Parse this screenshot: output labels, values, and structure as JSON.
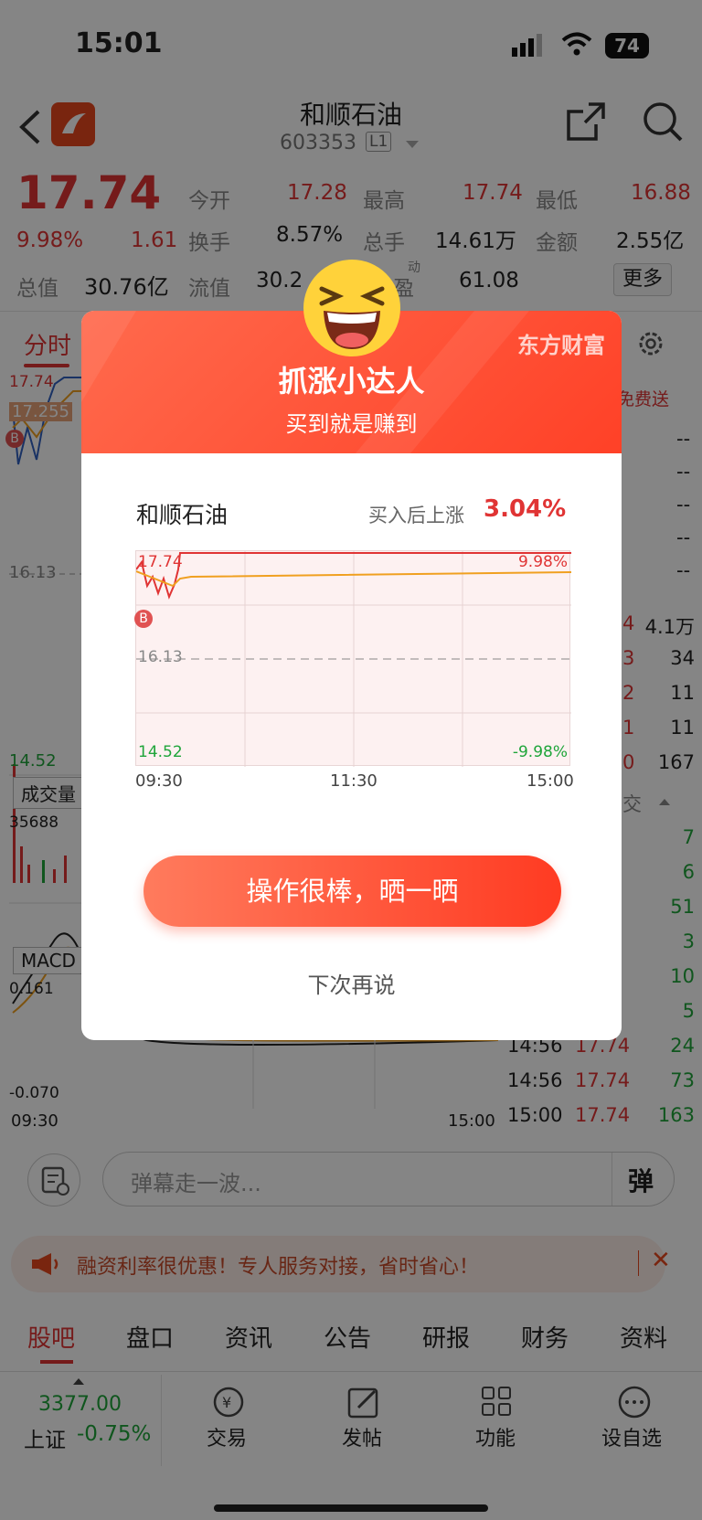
{
  "status": {
    "time": "15:01",
    "battery": "74"
  },
  "header": {
    "stock_name": "和顺石油",
    "code": "603353",
    "level": "L1"
  },
  "quote": {
    "price": "17.74",
    "pct": "9.98%",
    "chg": "1.61",
    "open_label": "今开",
    "open": "17.28",
    "high_label": "最高",
    "high": "17.74",
    "low_label": "最低",
    "low": "16.88",
    "turnover_label": "换手",
    "turnover": "8.57%",
    "vol_label": "总手",
    "vol": "14.61万",
    "amount_label": "金额",
    "amount": "2.55亿",
    "mcap_label": "总值",
    "mcap": "30.76亿",
    "float_label": "流值",
    "float": "30.2",
    "pe_label": "盈",
    "pe_sup": "动",
    "pe": "61.08",
    "more": "更多"
  },
  "tabs": {
    "active": "分时",
    "gift": "免费送"
  },
  "chart_labels": {
    "top": "17.74",
    "avg": "17.255",
    "mid": "16.13",
    "bottom": "14.52",
    "vol_tag": "成交量",
    "vol_max": "35688",
    "macd_tag": "MACD",
    "macd_top": "0.161",
    "macd_bot": "-0.070",
    "t_start": "09:30",
    "t_end": "15:00",
    "buy_marker": "B"
  },
  "orderbook": {
    "dashes": [
      "--",
      "--",
      "--",
      "--",
      "--",
      "--",
      "--",
      "--",
      "--",
      "--"
    ],
    "levels": [
      "4.1万",
      "34",
      "11",
      "11",
      "167"
    ],
    "level_prices": [
      "4",
      "3",
      "2",
      "1",
      "0"
    ],
    "trade_header": "交",
    "vols": [
      "7",
      "6",
      "51",
      "3",
      "10",
      "5"
    ],
    "trades": [
      {
        "t": "14:56",
        "p": "17.74",
        "v": "24"
      },
      {
        "t": "14:56",
        "p": "17.74",
        "v": "73"
      },
      {
        "t": "15:00",
        "p": "17.74",
        "v": "163"
      }
    ]
  },
  "comment": {
    "placeholder": "弹幕走一波...",
    "danmu": "弹"
  },
  "ad": {
    "text": "融资利率很优惠！专人服务对接，省时省心！"
  },
  "bottom_tabs": [
    "股吧",
    "盘口",
    "资讯",
    "公告",
    "研报",
    "财务",
    "资料"
  ],
  "toolbar": {
    "index_value": "3377.00",
    "index_name": "上证",
    "index_pct": "-0.75%",
    "trade": "交易",
    "post": "发帖",
    "func": "功能",
    "watch": "设自选"
  },
  "modal": {
    "brand": "东方财富",
    "title": "抓涨小达人",
    "subtitle": "买到就是赚到",
    "stock": "和顺石油",
    "gain_label": "买入后上涨",
    "gain": "3.04%",
    "chart": {
      "top": "17.74",
      "top_pct": "9.98%",
      "mid": "16.13",
      "bottom": "14.52",
      "bottom_pct": "-9.98%",
      "t1": "09:30",
      "t2": "11:30",
      "t3": "15:00",
      "marker": "B"
    },
    "cta": "操作很棒，晒一晒",
    "dismiss": "下次再说"
  },
  "colors": {
    "up": "#e03434",
    "down": "#1fa53a",
    "accent": "#ff4127",
    "avg": "#f0a020"
  }
}
